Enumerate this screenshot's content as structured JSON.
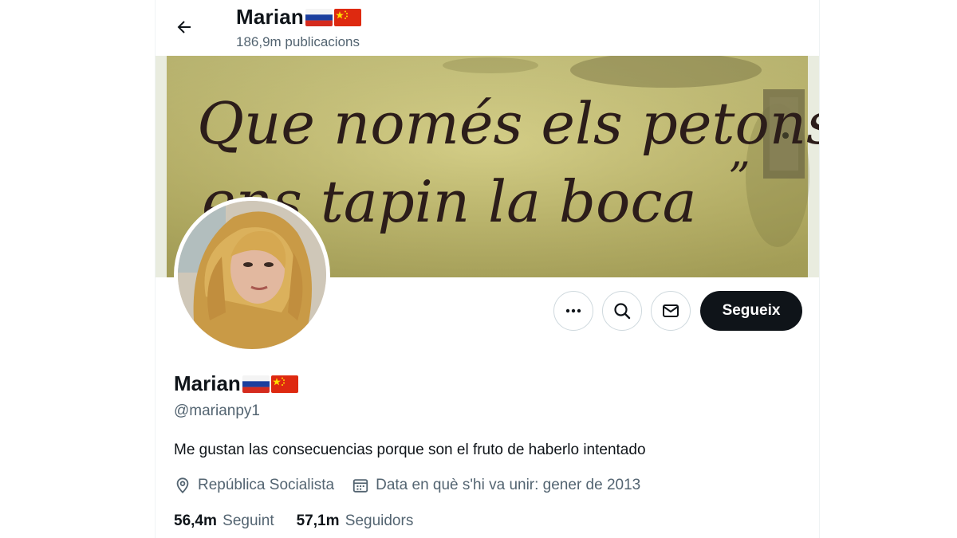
{
  "header": {
    "back_icon": "arrow-left-icon",
    "name": "Marian",
    "flags": [
      "russia-flag",
      "china-flag"
    ],
    "posts_count": "186,9m publicacions"
  },
  "banner": {
    "handwriting_line1": "Que només els petons",
    "handwriting_line2": "ens tapin la boca",
    "closing_quote": "”"
  },
  "actions": {
    "more_icon": "more-dots-icon",
    "search_icon": "search-icon",
    "message_icon": "envelope-icon",
    "follow_label": "Segueix"
  },
  "profile": {
    "name": "Marian",
    "handle": "@marianpy1",
    "bio": "Me gustan las consecuencias porque son el fruto de haberlo intentado",
    "location": "República Socialista",
    "joined": "Data en què s'hi va unir: gener de 2013",
    "following_count": "56,4m",
    "following_label": "Seguint",
    "followers_count": "57,1m",
    "followers_label": "Seguidors"
  },
  "colors": {
    "text_primary": "#0f1419",
    "text_secondary": "#536471",
    "border": "#cfd9de",
    "follow_bg": "#0f1419"
  }
}
